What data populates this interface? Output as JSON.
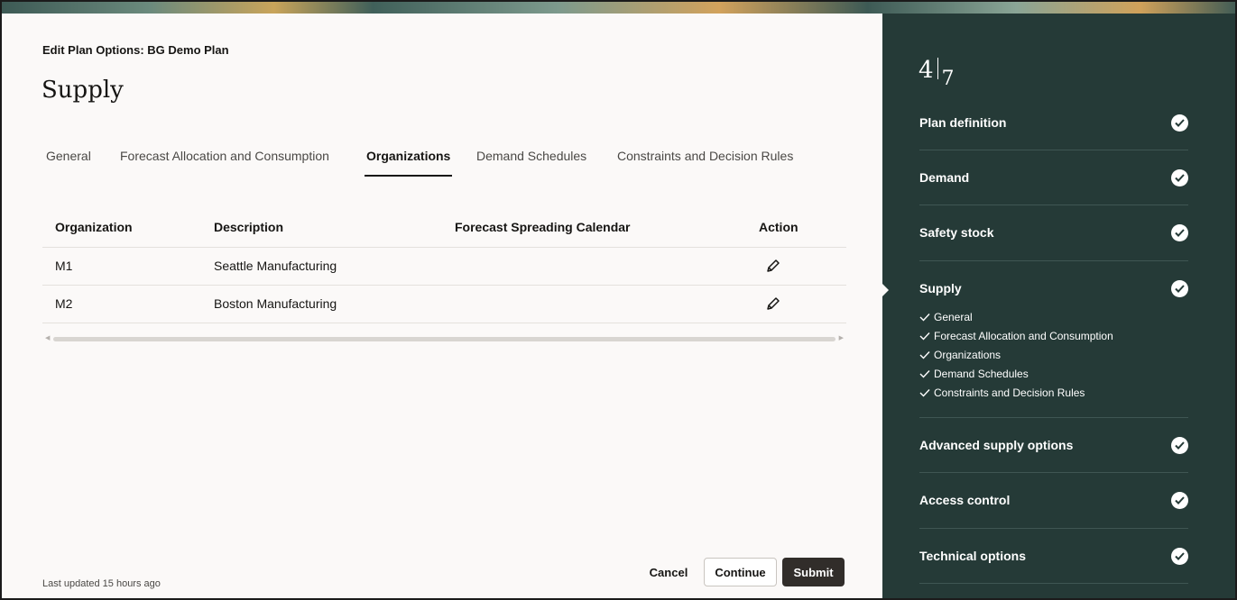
{
  "header": {
    "breadcrumb": "Edit Plan Options: BG Demo Plan",
    "title": "Supply"
  },
  "tabs": [
    {
      "label": "General"
    },
    {
      "label": "Forecast Allocation and Consumption"
    },
    {
      "label": "Organizations",
      "active": true
    },
    {
      "label": "Demand Schedules"
    },
    {
      "label": "Constraints and Decision Rules"
    }
  ],
  "table": {
    "columns": [
      "Organization",
      "Description",
      "Forecast Spreading Calendar",
      "Action"
    ],
    "rows": [
      {
        "organization": "M1",
        "description": "Seattle Manufacturing",
        "calendar": ""
      },
      {
        "organization": "M2",
        "description": "Boston Manufacturing",
        "calendar": ""
      }
    ]
  },
  "footer": {
    "last_updated": "Last updated 15 hours ago",
    "cancel": "Cancel",
    "continue": "Continue",
    "submit": "Submit"
  },
  "sidebar": {
    "current_step": "4",
    "total_steps": "7",
    "steps": [
      {
        "label": "Plan definition",
        "complete": true
      },
      {
        "label": "Demand",
        "complete": true
      },
      {
        "label": "Safety stock",
        "complete": true
      },
      {
        "label": "Supply",
        "complete": true,
        "current": true,
        "substeps": [
          "General",
          "Forecast Allocation and Consumption",
          "Organizations",
          "Demand Schedules",
          "Constraints and Decision Rules"
        ]
      },
      {
        "label": "Advanced supply options",
        "complete": true
      },
      {
        "label": "Access control",
        "complete": true
      },
      {
        "label": "Technical options",
        "complete": true
      }
    ]
  },
  "colors": {
    "sidebar_bg": "#253a37",
    "page_bg": "#fbf9f8",
    "primary_button": "#312d2a"
  },
  "icons": {
    "edit": "pencil-icon",
    "step_complete": "check-circle-icon",
    "substep_done": "checkmark-icon"
  }
}
